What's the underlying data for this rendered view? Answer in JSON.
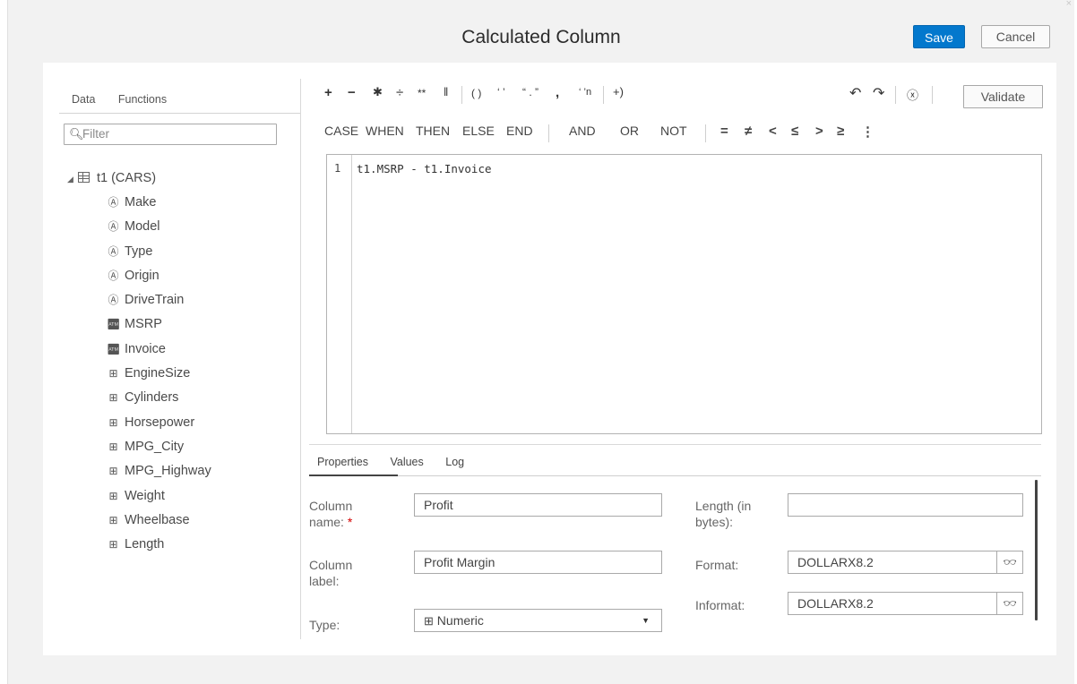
{
  "dialog": {
    "title": "Calculated Column",
    "save_label": "Save",
    "cancel_label": "Cancel",
    "close_label": "×"
  },
  "left": {
    "tabs": [
      "Data",
      "Functions"
    ],
    "filter_placeholder": "Filter",
    "root_label": "t1 (CARS)",
    "columns": [
      {
        "name": "Make",
        "icon": "character-icon"
      },
      {
        "name": "Model",
        "icon": "character-icon"
      },
      {
        "name": "Type",
        "icon": "character-icon"
      },
      {
        "name": "Origin",
        "icon": "character-icon"
      },
      {
        "name": "DriveTrain",
        "icon": "character-icon"
      },
      {
        "name": "MSRP",
        "icon": "currency-icon"
      },
      {
        "name": "Invoice",
        "icon": "currency-icon"
      },
      {
        "name": "EngineSize",
        "icon": "numeric-icon"
      },
      {
        "name": "Cylinders",
        "icon": "numeric-icon"
      },
      {
        "name": "Horsepower",
        "icon": "numeric-icon"
      },
      {
        "name": "MPG_City",
        "icon": "numeric-icon"
      },
      {
        "name": "MPG_Highway",
        "icon": "numeric-icon"
      },
      {
        "name": "Weight",
        "icon": "numeric-icon"
      },
      {
        "name": "Wheelbase",
        "icon": "numeric-icon"
      },
      {
        "name": "Length",
        "icon": "numeric-icon"
      }
    ]
  },
  "toolbar": {
    "operators": [
      "+",
      "−",
      "✱",
      "÷",
      "**",
      "‖"
    ],
    "groups": [
      "( )",
      "‘ ’",
      "“ . ”",
      ",",
      "‘ ’n",
      "+)"
    ],
    "validate_label": "Validate",
    "keywords": [
      "CASE",
      "WHEN",
      "THEN",
      "ELSE",
      "END"
    ],
    "logic": [
      "AND",
      "OR",
      "NOT"
    ],
    "comparisons": [
      "=",
      "≠",
      "<",
      "≤",
      ">",
      "≥",
      "⋮"
    ]
  },
  "editor": {
    "line_number": "1",
    "code": "t1.MSRP - t1.Invoice"
  },
  "properties": {
    "tabs": [
      "Properties",
      "Values",
      "Log"
    ],
    "column_name_label": "Column name:",
    "column_name_value": "Profit",
    "column_label_label": "Column label:",
    "column_label_value": "Profit Margin",
    "type_label": "Type:",
    "type_value": "Numeric",
    "length_label": "Length (in bytes):",
    "length_value": "",
    "format_label": "Format:",
    "format_value": "DOLLARX8.2",
    "informat_label": "Informat:",
    "informat_value": "DOLLARX8.2",
    "required_mark": "*"
  }
}
